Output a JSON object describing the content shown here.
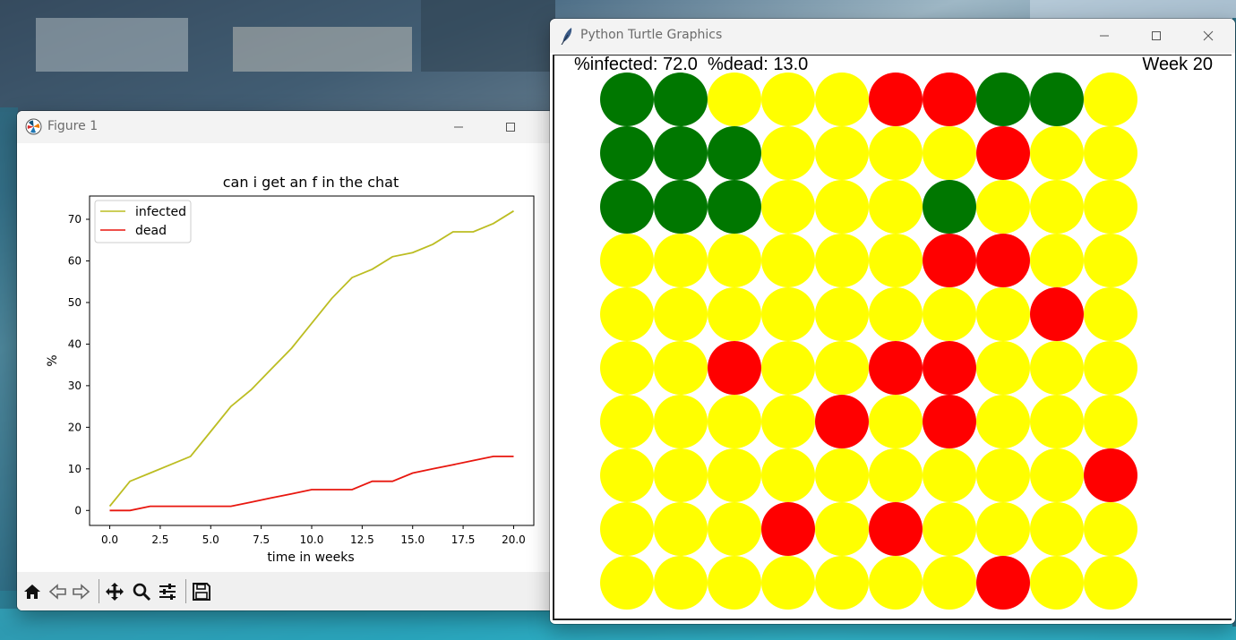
{
  "figure_window": {
    "title": "Figure 1",
    "icon": "matplotlib-icon",
    "controls": [
      "minimize-icon",
      "maximize-icon"
    ],
    "toolbar": [
      "home-icon",
      "back-arrow-icon",
      "forward-arrow-icon",
      "pan-move-icon",
      "zoom-magnifier-icon",
      "configure-subplots-icon",
      "save-floppy-icon"
    ]
  },
  "turtle_window": {
    "title": "Python Turtle Graphics",
    "icon": "feather-icon",
    "controls": [
      "minimize-icon",
      "maximize-icon",
      "close-icon"
    ],
    "status_left": "%infected: 72.0  %dead: 13.0",
    "status_right": "Week 20",
    "colors": {
      "infected": "#ffff00",
      "dead": "#ff0000",
      "healthy": "#007700"
    },
    "grid": [
      [
        "G",
        "G",
        "Y",
        "Y",
        "Y",
        "R",
        "R",
        "G",
        "G",
        "Y"
      ],
      [
        "G",
        "G",
        "G",
        "Y",
        "Y",
        "Y",
        "Y",
        "R",
        "Y",
        "Y"
      ],
      [
        "G",
        "G",
        "G",
        "Y",
        "Y",
        "Y",
        "G",
        "Y",
        "Y",
        "Y"
      ],
      [
        "Y",
        "Y",
        "Y",
        "Y",
        "Y",
        "Y",
        "R",
        "R",
        "Y",
        "Y"
      ],
      [
        "Y",
        "Y",
        "Y",
        "Y",
        "Y",
        "Y",
        "Y",
        "Y",
        "R",
        "Y"
      ],
      [
        "Y",
        "Y",
        "R",
        "Y",
        "Y",
        "R",
        "R",
        "Y",
        "Y",
        "Y"
      ],
      [
        "Y",
        "Y",
        "Y",
        "Y",
        "R",
        "Y",
        "R",
        "Y",
        "Y",
        "Y"
      ],
      [
        "Y",
        "Y",
        "Y",
        "Y",
        "Y",
        "Y",
        "Y",
        "Y",
        "Y",
        "R"
      ],
      [
        "Y",
        "Y",
        "Y",
        "R",
        "Y",
        "R",
        "Y",
        "Y",
        "Y",
        "Y"
      ],
      [
        "Y",
        "Y",
        "Y",
        "Y",
        "Y",
        "Y",
        "Y",
        "R",
        "Y",
        "Y"
      ]
    ]
  },
  "chart_data": {
    "type": "line",
    "title": "can i get an f in the chat",
    "xlabel": "time in weeks",
    "ylabel": "%",
    "x": [
      0,
      1,
      2,
      3,
      4,
      5,
      6,
      7,
      8,
      9,
      10,
      11,
      12,
      13,
      14,
      15,
      16,
      17,
      18,
      19,
      20
    ],
    "xlim": [
      -1,
      21
    ],
    "ylim": [
      -3.6,
      75.6
    ],
    "xticks": [
      "0.0",
      "2.5",
      "5.0",
      "7.5",
      "10.0",
      "12.5",
      "15.0",
      "17.5",
      "20.0"
    ],
    "xtick_values": [
      0,
      2.5,
      5,
      7.5,
      10,
      12.5,
      15,
      17.5,
      20
    ],
    "yticks": [
      "0",
      "10",
      "20",
      "30",
      "40",
      "50",
      "60",
      "70"
    ],
    "ytick_values": [
      0,
      10,
      20,
      30,
      40,
      50,
      60,
      70
    ],
    "legend_position": "top-left",
    "series": [
      {
        "name": "infected",
        "color": "#bcbd22",
        "values": [
          1,
          7,
          9,
          11,
          13,
          19,
          25,
          29,
          34,
          39,
          45,
          51,
          56,
          58,
          61,
          62,
          64,
          67,
          67,
          69,
          72
        ]
      },
      {
        "name": "dead",
        "color": "#e8170f",
        "values": [
          0,
          0,
          1,
          1,
          1,
          1,
          1,
          2,
          3,
          4,
          5,
          5,
          5,
          7,
          7,
          9,
          10,
          11,
          12,
          13,
          13
        ]
      }
    ]
  }
}
